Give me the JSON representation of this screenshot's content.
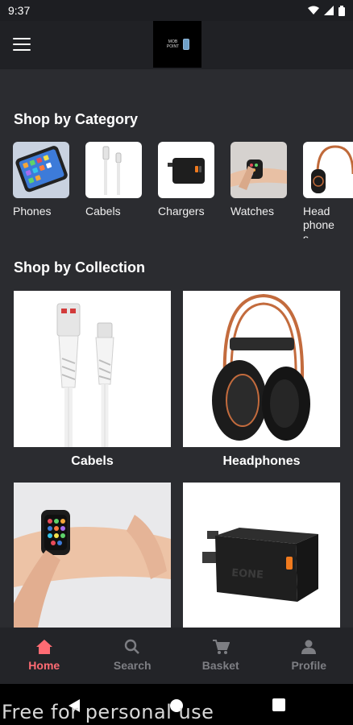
{
  "status_bar": {
    "time": "9:37"
  },
  "app_bar": {
    "logo_text": "MOB POINT"
  },
  "categories": {
    "title": "Shop by Category",
    "items": [
      {
        "label": "Phones"
      },
      {
        "label": "Cabels"
      },
      {
        "label": "Chargers"
      },
      {
        "label": "Watches"
      },
      {
        "label": "Headphones"
      }
    ]
  },
  "collections": {
    "title": "Shop by Collection",
    "items": [
      {
        "label": "Cabels"
      },
      {
        "label": "Headphones"
      },
      {
        "label": ""
      },
      {
        "label": ""
      }
    ]
  },
  "bottom_nav": {
    "items": [
      {
        "label": "Home",
        "icon": "home-icon"
      },
      {
        "label": "Search",
        "icon": "search-icon"
      },
      {
        "label": "Basket",
        "icon": "cart-icon"
      },
      {
        "label": "Profile",
        "icon": "person-icon"
      }
    ]
  },
  "watermark": "Free for personal use",
  "colors": {
    "accent": "#ff6b73",
    "background": "#2b2c30",
    "nav_inactive": "#7d7e83"
  }
}
